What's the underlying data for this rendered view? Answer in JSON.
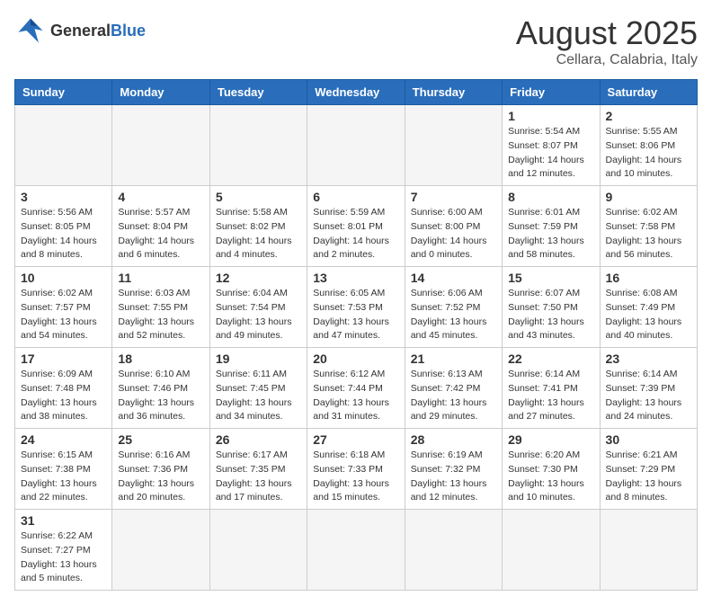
{
  "header": {
    "logo_general": "General",
    "logo_blue": "Blue",
    "month": "August 2025",
    "location": "Cellara, Calabria, Italy"
  },
  "days_of_week": [
    "Sunday",
    "Monday",
    "Tuesday",
    "Wednesday",
    "Thursday",
    "Friday",
    "Saturday"
  ],
  "weeks": [
    [
      {
        "day": "",
        "info": ""
      },
      {
        "day": "",
        "info": ""
      },
      {
        "day": "",
        "info": ""
      },
      {
        "day": "",
        "info": ""
      },
      {
        "day": "",
        "info": ""
      },
      {
        "day": "1",
        "info": "Sunrise: 5:54 AM\nSunset: 8:07 PM\nDaylight: 14 hours\nand 12 minutes."
      },
      {
        "day": "2",
        "info": "Sunrise: 5:55 AM\nSunset: 8:06 PM\nDaylight: 14 hours\nand 10 minutes."
      }
    ],
    [
      {
        "day": "3",
        "info": "Sunrise: 5:56 AM\nSunset: 8:05 PM\nDaylight: 14 hours\nand 8 minutes."
      },
      {
        "day": "4",
        "info": "Sunrise: 5:57 AM\nSunset: 8:04 PM\nDaylight: 14 hours\nand 6 minutes."
      },
      {
        "day": "5",
        "info": "Sunrise: 5:58 AM\nSunset: 8:02 PM\nDaylight: 14 hours\nand 4 minutes."
      },
      {
        "day": "6",
        "info": "Sunrise: 5:59 AM\nSunset: 8:01 PM\nDaylight: 14 hours\nand 2 minutes."
      },
      {
        "day": "7",
        "info": "Sunrise: 6:00 AM\nSunset: 8:00 PM\nDaylight: 14 hours\nand 0 minutes."
      },
      {
        "day": "8",
        "info": "Sunrise: 6:01 AM\nSunset: 7:59 PM\nDaylight: 13 hours\nand 58 minutes."
      },
      {
        "day": "9",
        "info": "Sunrise: 6:02 AM\nSunset: 7:58 PM\nDaylight: 13 hours\nand 56 minutes."
      }
    ],
    [
      {
        "day": "10",
        "info": "Sunrise: 6:02 AM\nSunset: 7:57 PM\nDaylight: 13 hours\nand 54 minutes."
      },
      {
        "day": "11",
        "info": "Sunrise: 6:03 AM\nSunset: 7:55 PM\nDaylight: 13 hours\nand 52 minutes."
      },
      {
        "day": "12",
        "info": "Sunrise: 6:04 AM\nSunset: 7:54 PM\nDaylight: 13 hours\nand 49 minutes."
      },
      {
        "day": "13",
        "info": "Sunrise: 6:05 AM\nSunset: 7:53 PM\nDaylight: 13 hours\nand 47 minutes."
      },
      {
        "day": "14",
        "info": "Sunrise: 6:06 AM\nSunset: 7:52 PM\nDaylight: 13 hours\nand 45 minutes."
      },
      {
        "day": "15",
        "info": "Sunrise: 6:07 AM\nSunset: 7:50 PM\nDaylight: 13 hours\nand 43 minutes."
      },
      {
        "day": "16",
        "info": "Sunrise: 6:08 AM\nSunset: 7:49 PM\nDaylight: 13 hours\nand 40 minutes."
      }
    ],
    [
      {
        "day": "17",
        "info": "Sunrise: 6:09 AM\nSunset: 7:48 PM\nDaylight: 13 hours\nand 38 minutes."
      },
      {
        "day": "18",
        "info": "Sunrise: 6:10 AM\nSunset: 7:46 PM\nDaylight: 13 hours\nand 36 minutes."
      },
      {
        "day": "19",
        "info": "Sunrise: 6:11 AM\nSunset: 7:45 PM\nDaylight: 13 hours\nand 34 minutes."
      },
      {
        "day": "20",
        "info": "Sunrise: 6:12 AM\nSunset: 7:44 PM\nDaylight: 13 hours\nand 31 minutes."
      },
      {
        "day": "21",
        "info": "Sunrise: 6:13 AM\nSunset: 7:42 PM\nDaylight: 13 hours\nand 29 minutes."
      },
      {
        "day": "22",
        "info": "Sunrise: 6:14 AM\nSunset: 7:41 PM\nDaylight: 13 hours\nand 27 minutes."
      },
      {
        "day": "23",
        "info": "Sunrise: 6:14 AM\nSunset: 7:39 PM\nDaylight: 13 hours\nand 24 minutes."
      }
    ],
    [
      {
        "day": "24",
        "info": "Sunrise: 6:15 AM\nSunset: 7:38 PM\nDaylight: 13 hours\nand 22 minutes."
      },
      {
        "day": "25",
        "info": "Sunrise: 6:16 AM\nSunset: 7:36 PM\nDaylight: 13 hours\nand 20 minutes."
      },
      {
        "day": "26",
        "info": "Sunrise: 6:17 AM\nSunset: 7:35 PM\nDaylight: 13 hours\nand 17 minutes."
      },
      {
        "day": "27",
        "info": "Sunrise: 6:18 AM\nSunset: 7:33 PM\nDaylight: 13 hours\nand 15 minutes."
      },
      {
        "day": "28",
        "info": "Sunrise: 6:19 AM\nSunset: 7:32 PM\nDaylight: 13 hours\nand 12 minutes."
      },
      {
        "day": "29",
        "info": "Sunrise: 6:20 AM\nSunset: 7:30 PM\nDaylight: 13 hours\nand 10 minutes."
      },
      {
        "day": "30",
        "info": "Sunrise: 6:21 AM\nSunset: 7:29 PM\nDaylight: 13 hours\nand 8 minutes."
      }
    ],
    [
      {
        "day": "31",
        "info": "Sunrise: 6:22 AM\nSunset: 7:27 PM\nDaylight: 13 hours\nand 5 minutes."
      },
      {
        "day": "",
        "info": ""
      },
      {
        "day": "",
        "info": ""
      },
      {
        "day": "",
        "info": ""
      },
      {
        "day": "",
        "info": ""
      },
      {
        "day": "",
        "info": ""
      },
      {
        "day": "",
        "info": ""
      }
    ]
  ]
}
